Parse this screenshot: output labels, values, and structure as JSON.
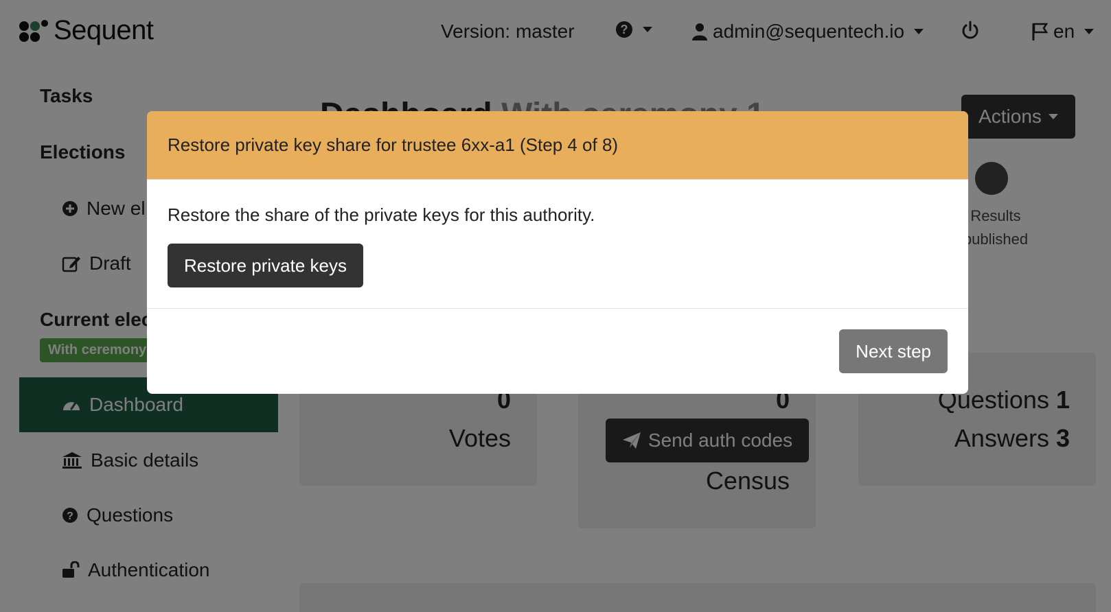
{
  "header": {
    "logo_text": "Sequent",
    "version_label": "Version: master",
    "user_email": "admin@sequentech.io",
    "language": "en"
  },
  "sidebar": {
    "tasks_heading": "Tasks",
    "elections_heading": "Elections",
    "new_election_label": "New el",
    "draft_label": "Draft",
    "current_election_heading": "Current elec",
    "current_election_badge": "With ceremony",
    "items": [
      {
        "label": "Dashboard"
      },
      {
        "label": "Basic details"
      },
      {
        "label": "Questions"
      },
      {
        "label": "Authentication"
      }
    ]
  },
  "main": {
    "title_prefix": "Dashboard",
    "title_suffix": "With ceremony 1",
    "actions_label": "Actions",
    "step_label": "Results published",
    "votes_count": "0",
    "votes_label": "Votes",
    "census_count": "0",
    "send_auth_codes_label": "Send auth codes",
    "census_label": "Census",
    "questions_label": "Questions",
    "questions_count": "1",
    "answers_label": "Answers",
    "answers_count": "3"
  },
  "modal": {
    "title": "Restore private key share for trustee 6xx-a1 (Step 4 of 8)",
    "body_text": "Restore the share of the private keys for this authority.",
    "restore_button_label": "Restore private keys",
    "next_button_label": "Next step"
  },
  "colors": {
    "modal_header_bg": "#e8ae5c",
    "sidebar_active_bg": "#1d5e43",
    "badge_bg": "#5aa94e",
    "dark_button_bg": "#333333",
    "gray_button_bg": "#777777"
  }
}
